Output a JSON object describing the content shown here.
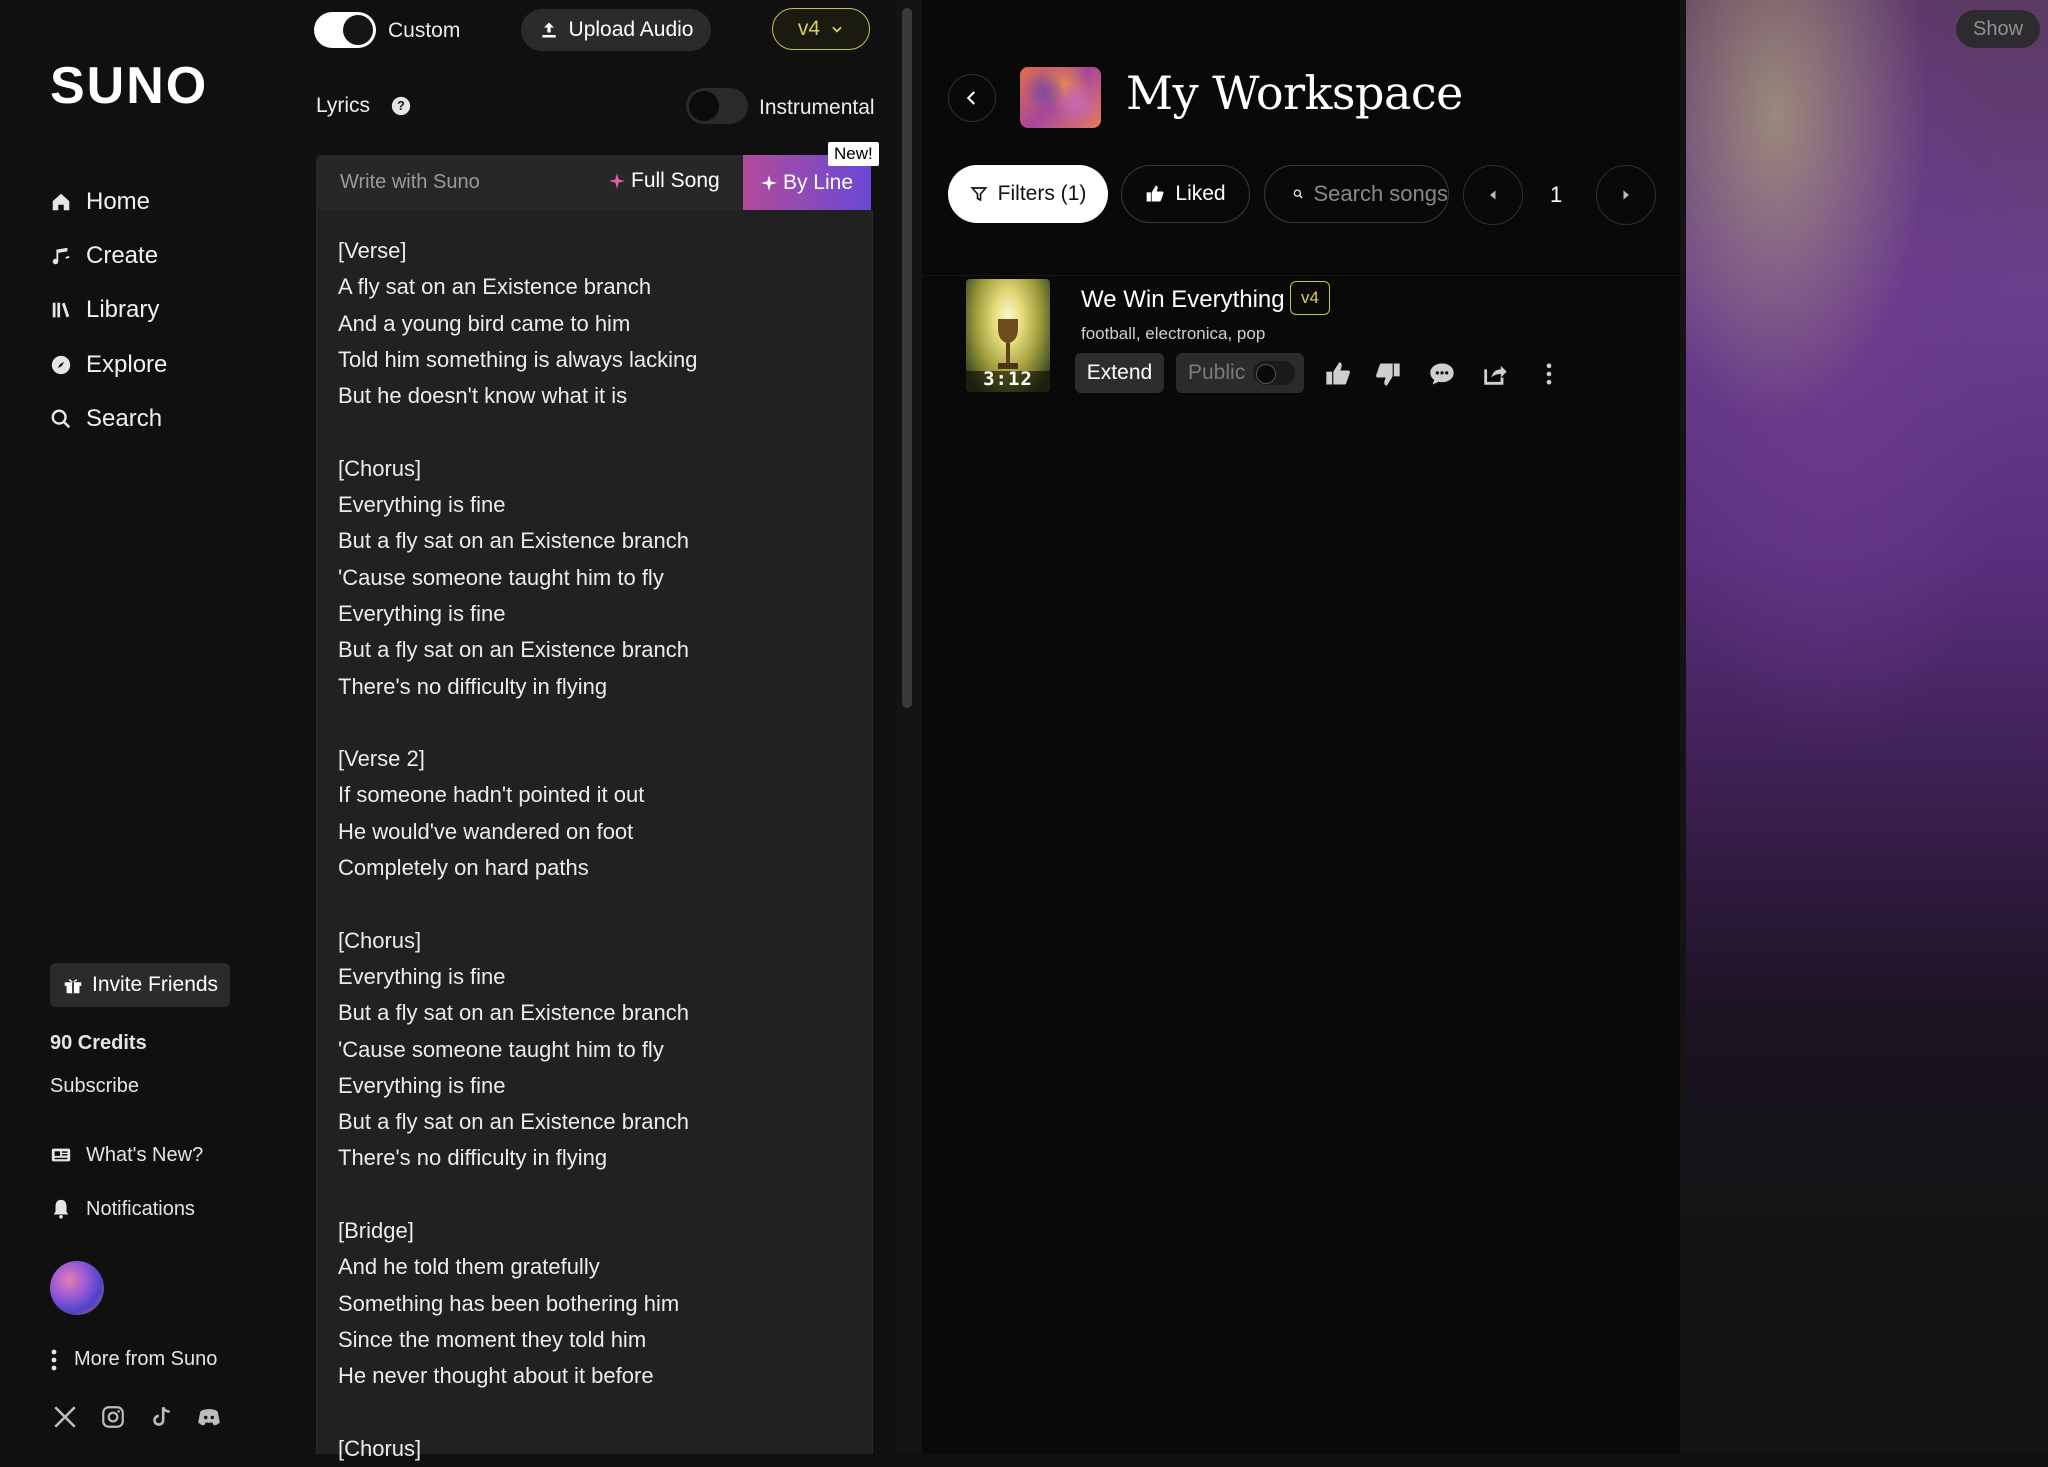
{
  "sidebar": {
    "logo": "SUNO",
    "nav": [
      {
        "label": "Home",
        "icon": "home-icon"
      },
      {
        "label": "Create",
        "icon": "music-note-icon"
      },
      {
        "label": "Library",
        "icon": "library-icon"
      },
      {
        "label": "Explore",
        "icon": "compass-icon"
      },
      {
        "label": "Search",
        "icon": "search-icon"
      }
    ],
    "invite_label": "Invite Friends",
    "credits": "90 Credits",
    "subscribe": "Subscribe",
    "whats_new": "What's New?",
    "notifications": "Notifications",
    "more_from": "More from Suno"
  },
  "create": {
    "custom_label": "Custom",
    "upload_label": "Upload Audio",
    "model_label": "v4",
    "lyrics_label": "Lyrics",
    "instrumental_label": "Instrumental",
    "write_with_placeholder": "Write with Suno",
    "full_song_label": "Full Song",
    "by_line_label": "By Line",
    "new_badge": "New!",
    "lyrics": "[Verse]\nA fly sat on an Existence branch\nAnd a young bird came to him\nTold him something is always lacking\nBut he doesn't know what it is\n\n[Chorus]\nEverything is fine\nBut a fly sat on an Existence branch\n'Cause someone taught him to fly\nEverything is fine\nBut a fly sat on an Existence branch\nThere's no difficulty in flying\n\n[Verse 2]\nIf someone hadn't pointed it out\nHe would've wandered on foot\nCompletely on hard paths\n\n[Chorus]\nEverything is fine\nBut a fly sat on an Existence branch\n'Cause someone taught him to fly\nEverything is fine\nBut a fly sat on an Existence branch\nThere's no difficulty in flying\n\n[Bridge]\nAnd he told them gratefully\nSomething has been bothering him\nSince the moment they told him\nHe never thought about it before\n\n[Chorus]"
  },
  "workspace": {
    "title": "My Workspace",
    "filters_label": "Filters (1)",
    "liked_label": "Liked",
    "search_placeholder": "Search songs",
    "page_number": "1",
    "songs": [
      {
        "title": "We Win Everything",
        "version": "v4",
        "tags": "football, electronica, pop",
        "duration": "3:12",
        "extend_label": "Extend",
        "public_label": "Public"
      }
    ]
  },
  "right_panel": {
    "show_label": "Show"
  },
  "colors": {
    "accent_yellow": "#d9d15a",
    "by_line_gradient_start": "#b24a9a",
    "by_line_gradient_end": "#6a49d6"
  }
}
